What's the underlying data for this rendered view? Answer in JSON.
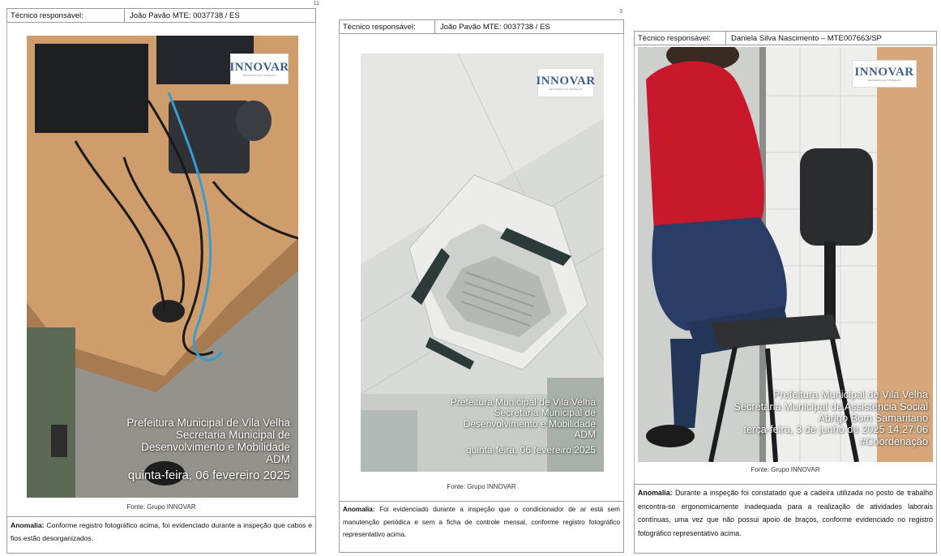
{
  "panels": [
    {
      "header_label": "Técnico responsável:",
      "header_value": "João Pavão MTE: 0037738 / ES",
      "overlay_lines": [
        "Prefeitura Municipal de Vila Velha",
        "Secretaria Municipal de",
        "Desenvolvimento e Mobilidade",
        "ADM",
        "quinta-feira, 06 fevereiro 2025"
      ],
      "logo_text": "INNOVAR",
      "source": "Fonte: Grupo INNOVAR",
      "anomaly_label": "Anomalia:",
      "anomaly_text": "Conforme registro fotográfico acima, foi evidenciado durante a inspeção que cabos e fios estão desorganizados."
    },
    {
      "header_label": "Técnico responsável:",
      "header_value": "João Pavão MTE: 0037738 / ES",
      "overlay_lines": [
        "Prefeitura Municipal de Vila Velha",
        "Secretaria Municipal de",
        "Desenvolvimento e Mobilidade",
        "ADM",
        "quinta-feira, 06 fevereiro 2025"
      ],
      "logo_text": "INNOVAR",
      "source": "Fonte: Grupo INNOVAR",
      "anomaly_label": "Anomalia:",
      "anomaly_text": "Foi evidenciado durante a inspeção que o condicionador de ar está sem manutenção periódica e sem a ficha de controle mensal, conforme registro fotográfico representativo acima."
    },
    {
      "header_label": "Técnico responsável:",
      "header_value": "Daniela Silva Nascimento – MTE007663/SP",
      "overlay_lines": [
        "Prefeitura Municipal de Vila Velha",
        "Secretaria Municipal de Assistência Social",
        "Abrigo Bom Samaritano",
        "terça-feira, 3 de junho de 2025 14:27:06",
        "#Coordenação"
      ],
      "logo_text": "INNOVAR",
      "source": "Fonte: Grupo INNOVAR",
      "anomaly_label": "Anomalia:",
      "anomaly_text": "Durante a inspeção foi constatado que a cadeira utilizada no posto de trabalho encontra-se ergonomicamente inadequada para a realização de atividades laborais contínuas, uma vez que não possui apoio de braços, conforme evidenciado no registro fotográfico representativo acima."
    }
  ],
  "page_marks": [
    "11",
    "3"
  ]
}
